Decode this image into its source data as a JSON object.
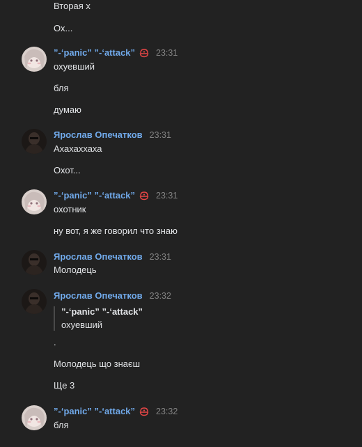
{
  "users": {
    "panic": "”-‘panic” ”-‘attack”",
    "yaroslav": "Ярослав Опечатков"
  },
  "messages": {
    "m0_line0": "Вторая х",
    "m0_line1": "Ох...",
    "m1_time": "23:31",
    "m1_line0": "охуевший",
    "m1_line1": "бля",
    "m1_line2": "думаю",
    "m2_time": "23:31",
    "m2_line0": "Ахахаххаха",
    "m2_line1": "Охот...",
    "m3_time": "23:31",
    "m3_line0": "охотник",
    "m3_line1": "ну вот, я же говорил что знаю",
    "m4_time": "23:31",
    "m4_line0": "Молодець",
    "m5_time": "23:32",
    "m5_quote_author": "”-‘panic” ”-‘attack”",
    "m5_quote_text": "охуевший",
    "m5_line0": ".",
    "m5_line1": "Молодець що знаєш",
    "m5_line2": "Ще 3",
    "m6_time": "23:32",
    "m6_line0": "бля"
  },
  "colors": {
    "background": "#222222",
    "author_link": "#71aaeb",
    "text": "#e1e3e6",
    "time": "#828282",
    "badge": "#e64646"
  },
  "icons": {
    "badge": "donut-badge-icon",
    "avatar_panic": "anime-girl-avatar",
    "avatar_yaroslav": "dark-photo-avatar"
  }
}
